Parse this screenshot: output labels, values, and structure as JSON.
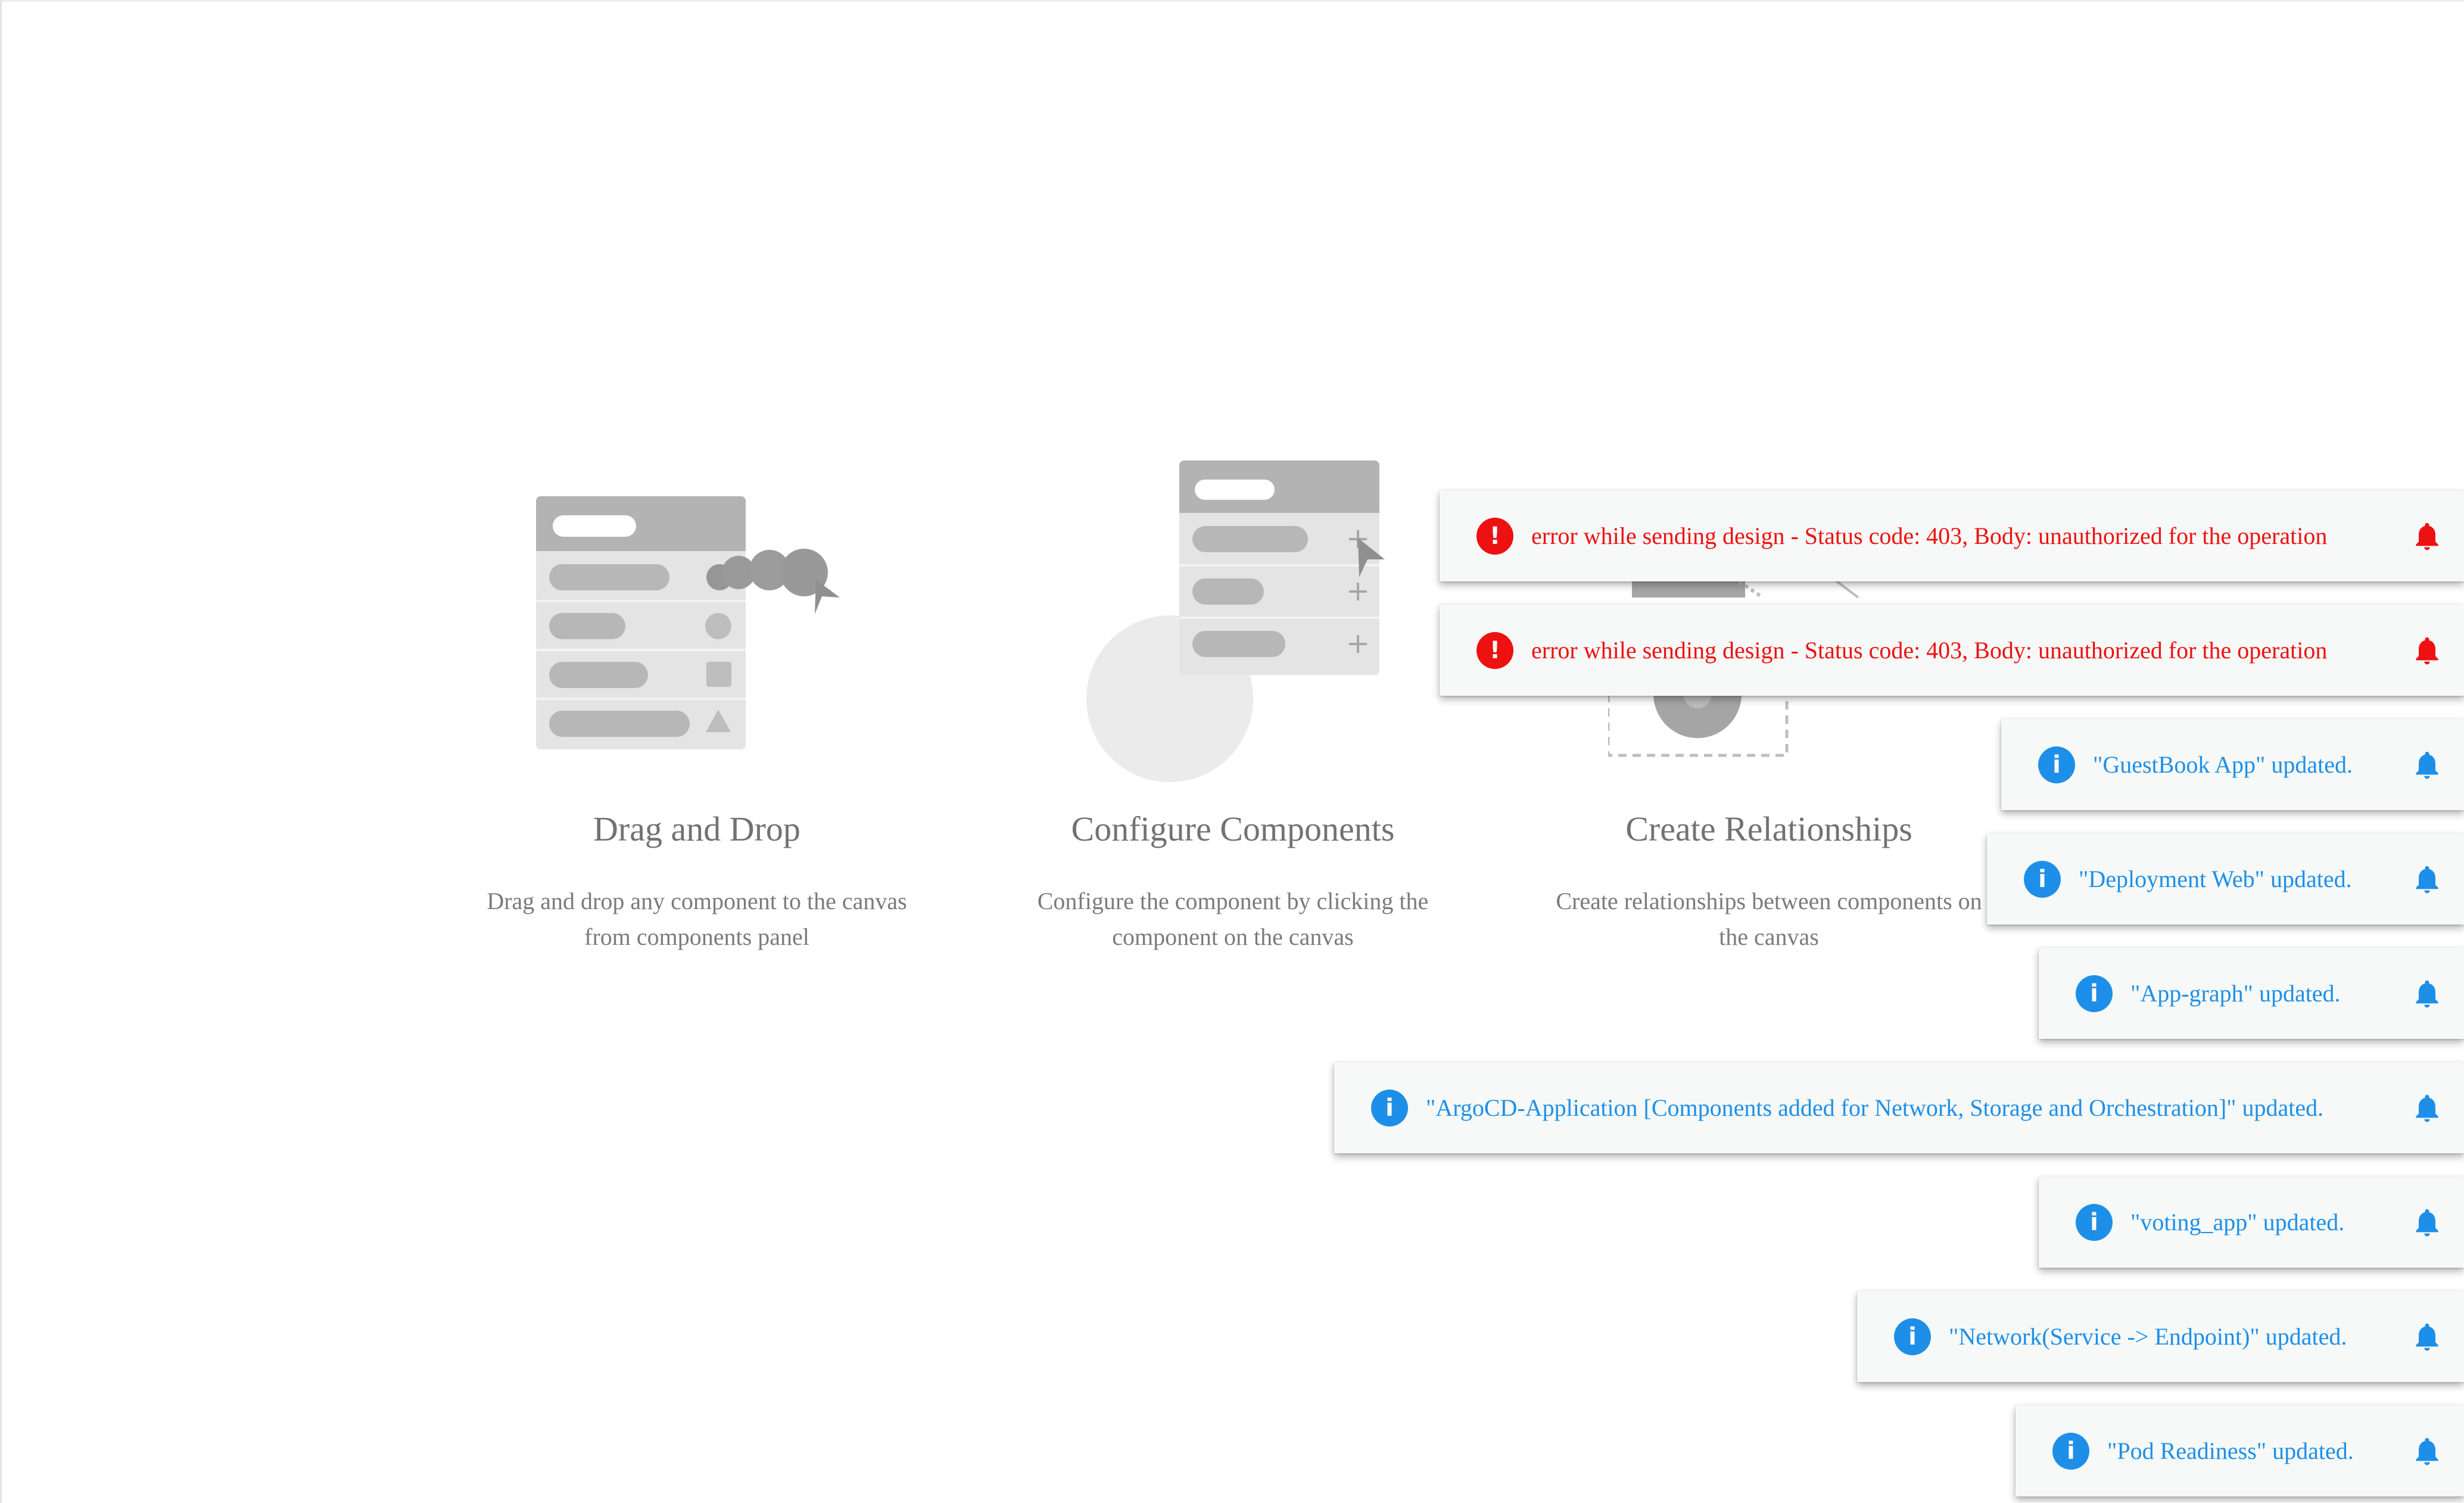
{
  "features": [
    {
      "title": "Drag and Drop",
      "desc_line1": "Drag and drop any component to the canvas",
      "desc_line2": "from components panel"
    },
    {
      "title": "Configure Components",
      "desc_line1": "Configure the component by clicking the",
      "desc_line2": "component on the canvas"
    },
    {
      "title": "Create Relationships",
      "desc_line1": "Create relationships between components on",
      "desc_line2": "the canvas"
    }
  ],
  "notifications": [
    {
      "type": "error",
      "badge": "!",
      "icon": "bell-icon",
      "message": "error while sending design - Status code: 403, Body: unauthorized for the operation"
    },
    {
      "type": "error",
      "badge": "!",
      "icon": "bell-icon",
      "message": "error while sending design - Status code: 403, Body: unauthorized for the operation"
    },
    {
      "type": "info",
      "badge": "i",
      "icon": "bell-icon",
      "message": "\"GuestBook App\" updated."
    },
    {
      "type": "info",
      "badge": "i",
      "icon": "bell-icon",
      "message": "\"Deployment Web\" updated."
    },
    {
      "type": "info",
      "badge": "i",
      "icon": "bell-icon",
      "message": "\"App-graph\" updated."
    },
    {
      "type": "info",
      "badge": "i",
      "icon": "bell-icon",
      "message": "\"ArgoCD-Application [Components added for Network, Storage and Orchestration]\" updated."
    },
    {
      "type": "info",
      "badge": "i",
      "icon": "bell-icon",
      "message": "\"voting_app\" updated."
    },
    {
      "type": "info",
      "badge": "i",
      "icon": "bell-icon",
      "message": "\"Network(Service -> Endpoint)\" updated."
    },
    {
      "type": "info",
      "badge": "i",
      "icon": "bell-icon",
      "message": "\"Pod Readiness\" updated."
    }
  ],
  "colors": {
    "error": "#ee1111",
    "info": "#1e8fe8",
    "toast_bg": "#f6f9f7",
    "muted_text": "#7b7b7b"
  }
}
